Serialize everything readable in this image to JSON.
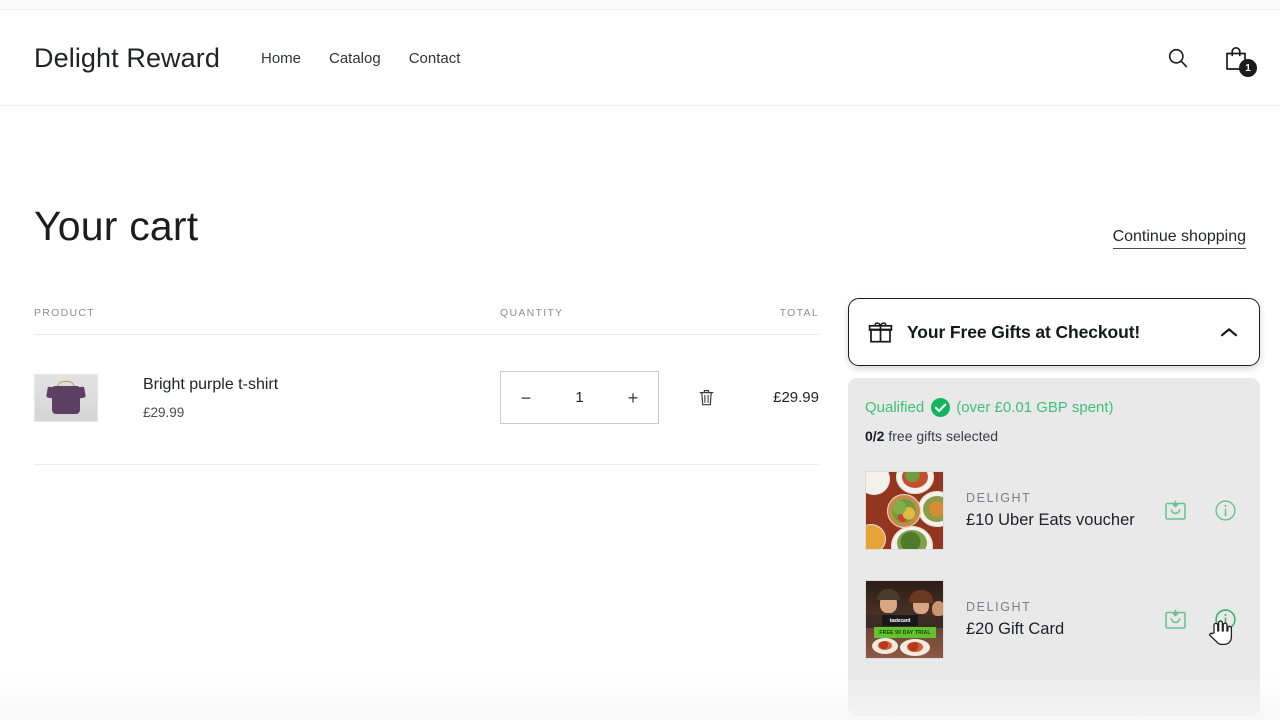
{
  "header": {
    "brand": "Delight Reward",
    "nav": [
      {
        "label": "Home"
      },
      {
        "label": "Catalog"
      },
      {
        "label": "Contact"
      }
    ],
    "search_icon": "search-icon",
    "cart_icon": "shopping-bag-icon",
    "cart_count": "1"
  },
  "cart": {
    "title": "Your cart",
    "continue_link": "Continue shopping",
    "columns": {
      "product": "PRODUCT",
      "quantity": "QUANTITY",
      "total": "TOTAL"
    },
    "items": [
      {
        "name": "Bright purple t-shirt",
        "unit_price": "£29.99",
        "quantity": "1",
        "total": "£29.99",
        "decrease_label": "−",
        "increase_label": "+",
        "remove_icon": "trash-icon",
        "thumb_alt": "purple-tshirt-thumbnail"
      }
    ]
  },
  "gifts_widget": {
    "header_title": "Your Free Gifts at Checkout!",
    "header_icon": "gift-icon",
    "collapse_icon": "chevron-up-icon",
    "qualified_text": "Qualified",
    "qualified_icon": "check-circle-icon",
    "qualified_note": "(over £0.01 GBP spent)",
    "selected_count": "0/2",
    "selected_suffix": "free gifts selected",
    "accent_green": "#3fbf7b",
    "panel_bg": "#e9e9e9",
    "items": [
      {
        "brand": "DELIGHT",
        "name": "£10 Uber Eats voucher",
        "thumb_alt": "food-bowls-thumbnail",
        "add_icon": "add-to-bag-icon",
        "info_icon": "info-circle-icon"
      },
      {
        "brand": "DELIGHT",
        "name": "£20 Gift Card",
        "thumb_alt": "restaurant-diners-thumbnail",
        "add_icon": "add-to-bag-icon",
        "info_icon": "info-circle-icon",
        "thumb_logo": "tastecard",
        "thumb_banner": "FREE 90 DAY TRIAL"
      }
    ]
  },
  "cursor": {
    "icon": "hand-pointer-cursor"
  }
}
